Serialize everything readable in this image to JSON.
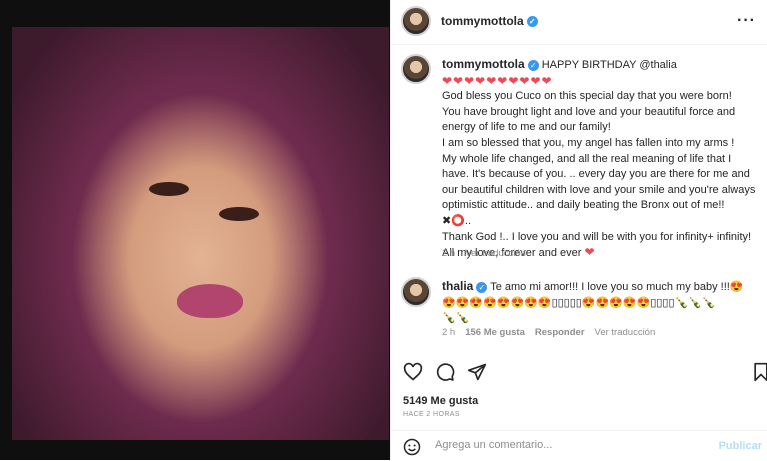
{
  "post": {
    "author": "tommymottola",
    "caption": {
      "author": "tommymottola",
      "first_line": "HAPPY BIRTHDAY @thalia",
      "hearts": "❤❤❤❤❤❤❤❤❤❤",
      "line1": "God bless you Cuco on this special day that you were born!",
      "line2": "You have brought light and love and your beautiful force and energy of life to me and our family!",
      "line3": "I am so blessed that you, my angel has fallen into my arms !",
      "line4": "My whole life changed, and all the real meaning of life that I have. It's because of you. .. every day you are there for me and our beautiful children with love and your smile and you're always optimistic attitude.. and daily beating the Bronx out of me!!",
      "emojis": "✖⭕..",
      "line5": "Thank God !.. I love you and will be with you for infinity+ infinity!",
      "line6": "All my love, forever and ever",
      "heart_end": "❤"
    },
    "caption_time": "2 h",
    "caption_translate": "Ver traducción",
    "reply": {
      "author": "thalia",
      "text": "Te amo mi amor!!! I love you so much my baby !!!😍",
      "emojis": "😍😍😍😍😍😍😍😍▯▯▯▯▯😍😍😍😍😍▯▯▯▯🍾🍾🍾",
      "emojis2": "🍾🍾",
      "time": "2 h",
      "likes": "156 Me gusta",
      "respond": "Responder",
      "translate": "Ver traducción"
    },
    "likes": "5149 Me gusta",
    "time_ago": "HACE 2 HORAS",
    "comment_placeholder": "Agrega un comentario...",
    "publish": "Publicar"
  },
  "colors": {
    "verified": "#3897f0",
    "heart": "#ed4956",
    "meta": "#8e8e8e"
  },
  "icons": [
    "more-icon",
    "heart-icon",
    "comment-icon",
    "share-icon",
    "bookmark-icon",
    "emoji-icon"
  ]
}
